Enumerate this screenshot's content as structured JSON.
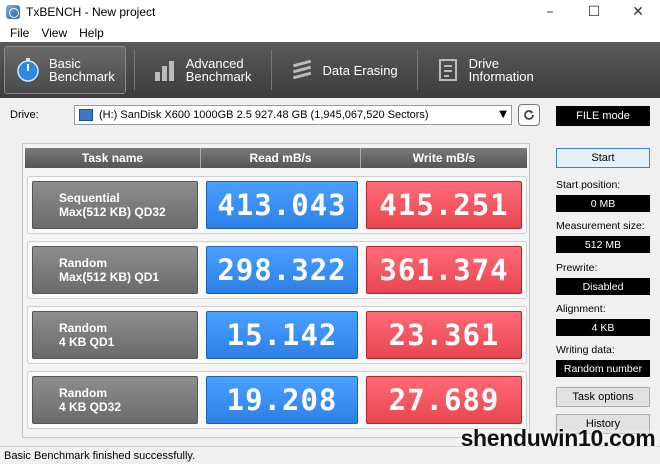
{
  "window": {
    "title": "TxBENCH - New project"
  },
  "menu": [
    "File",
    "View",
    "Help"
  ],
  "toolbar": {
    "buttons": [
      {
        "line1": "Basic",
        "line2": "Benchmark",
        "icon": "stopwatch-icon",
        "active": true
      },
      {
        "line1": "Advanced",
        "line2": "Benchmark",
        "icon": "bar-chart-icon",
        "active": false
      },
      {
        "line1": "Data Erasing",
        "line2": "",
        "icon": "eraser-icon",
        "active": false
      },
      {
        "line1": "Drive",
        "line2": "Information",
        "icon": "drive-info-icon",
        "active": false
      }
    ]
  },
  "drive": {
    "label": "Drive:",
    "selected": "(H:) SanDisk X600 1000GB 2.5  927.48 GB (1,945,067,520 Sectors)",
    "mode": "FILE mode"
  },
  "results": {
    "headers": [
      "Task name",
      "Read mB/s",
      "Write mB/s"
    ],
    "rows": [
      {
        "task1": "Sequential",
        "task2": "Max(512 KB) QD32",
        "read": "413.043",
        "write": "415.251"
      },
      {
        "task1": "Random",
        "task2": "Max(512 KB) QD1",
        "read": "298.322",
        "write": "361.374"
      },
      {
        "task1": "Random",
        "task2": "4 KB QD1",
        "read": "15.142",
        "write": "23.361"
      },
      {
        "task1": "Random",
        "task2": "4 KB QD32",
        "read": "19.208",
        "write": "27.689"
      }
    ]
  },
  "settings": {
    "start_label": "Start",
    "start_position_label": "Start position:",
    "start_position_value": "0 MB",
    "measurement_size_label": "Measurement size:",
    "measurement_size_value": "512 MB",
    "prewrite_label": "Prewrite:",
    "prewrite_value": "Disabled",
    "alignment_label": "Alignment:",
    "alignment_value": "4 KB",
    "writing_data_label": "Writing data:",
    "writing_data_value": "Random number",
    "task_options_label": "Task options",
    "history_label": "History"
  },
  "status": {
    "text": "Basic Benchmark finished successfully."
  },
  "watermark": "shenduwin10.com",
  "colors": {
    "read": "#2d7fe6",
    "write": "#e8464f",
    "toolbar": "#4a4a4a"
  }
}
